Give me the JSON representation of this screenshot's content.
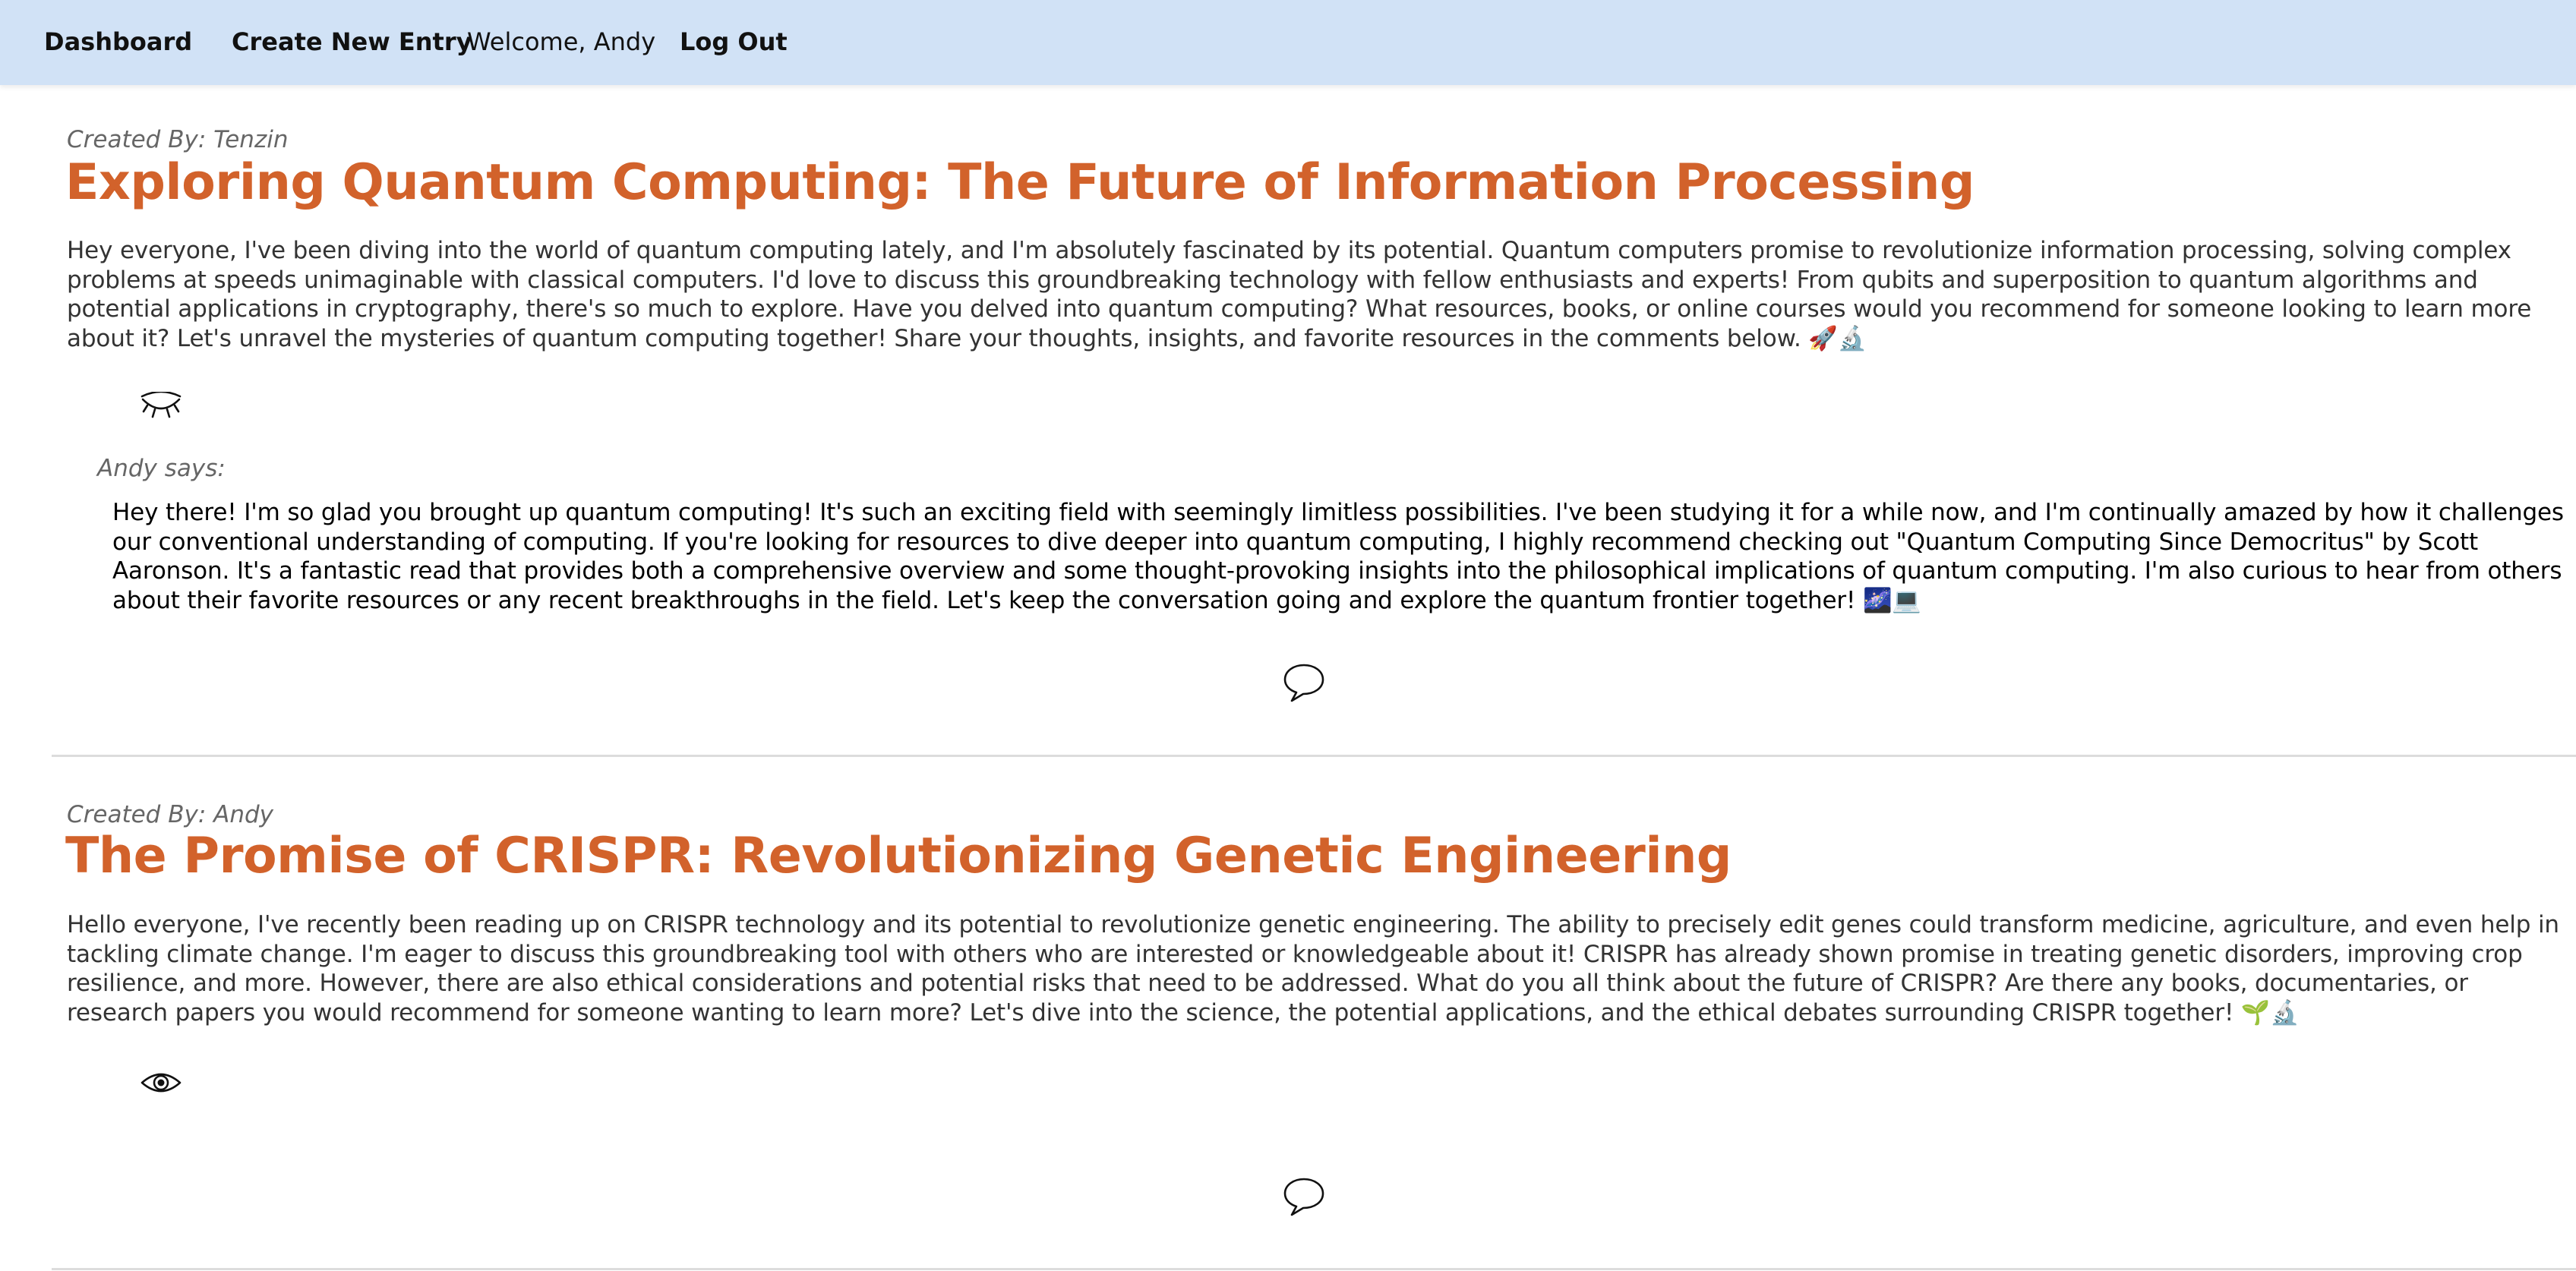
{
  "nav": {
    "dashboard": "Dashboard",
    "create": "Create New Entry",
    "welcome": "Welcome, Andy",
    "logout": "Log Out"
  },
  "posts": [
    {
      "created_by": "Created By: Tenzin",
      "title": "Exploring Quantum Computing: The Future of Information Processing",
      "body": "Hey everyone, I've been diving into the world of quantum computing lately, and I'm absolutely fascinated by its potential. Quantum computers promise to revolutionize information processing, solving complex problems at speeds unimaginable with classical computers. I'd love to discuss this groundbreaking technology with fellow enthusiasts and experts! From qubits and superposition to quantum algorithms and potential applications in cryptography, there's so much to explore. Have you delved into quantum computing? What resources, books, or online courses would you recommend for someone looking to learn more about it? Let's unravel the mysteries of quantum computing together! Share your thoughts, insights, and favorite resources in the comments below. 🚀🔬",
      "visibility_icon": "eye-closed-icon",
      "comments": [
        {
          "author": "Andy says:",
          "text": "Hey there! I'm so glad you brought up quantum computing! It's such an exciting field with seemingly limitless possibilities. I've been studying it for a while now, and I'm continually amazed by how it challenges our conventional understanding of computing. If you're looking for resources to dive deeper into quantum computing, I highly recommend checking out \"Quantum Computing Since Democritus\" by Scott Aaronson. It's a fantastic read that provides both a comprehensive overview and some thought-provoking insights into the philosophical implications of quantum computing. I'm also curious to hear from others about their favorite resources or any recent breakthroughs in the field. Let's keep the conversation going and explore the quantum frontier together! 🌌💻"
        }
      ],
      "comment_icon": "speech-bubble-icon"
    },
    {
      "created_by": "Created By: Andy",
      "title": "The Promise of CRISPR: Revolutionizing Genetic Engineering",
      "body": "Hello everyone, I've recently been reading up on CRISPR technology and its potential to revolutionize genetic engineering. The ability to precisely edit genes could transform medicine, agriculture, and even help in tackling climate change. I'm eager to discuss this groundbreaking tool with others who are interested or knowledgeable about it! CRISPR has already shown promise in treating genetic disorders, improving crop resilience, and more. However, there are also ethical considerations and potential risks that need to be addressed. What do you all think about the future of CRISPR? Are there any books, documentaries, or research papers you would recommend for someone wanting to learn more? Let's dive into the science, the potential applications, and the ethical debates surrounding CRISPR together! 🌱🔬",
      "visibility_icon": "eye-open-icon",
      "comments": [],
      "comment_icon": "speech-bubble-icon"
    }
  ],
  "colors": {
    "navbar_bg": "#d1e2f6",
    "title": "#d2622b",
    "divider": "#dcdcdc"
  }
}
